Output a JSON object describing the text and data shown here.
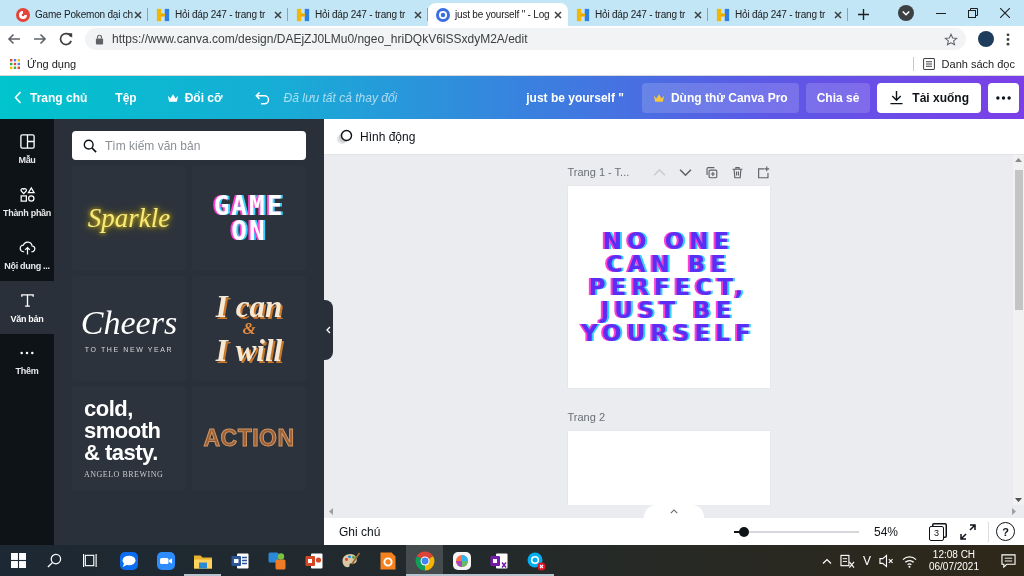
{
  "browser": {
    "tabs": [
      {
        "kind": "game",
        "title": "Game Pokemon đại ch",
        "selected": false
      },
      {
        "kind": "qa",
        "title": "Hỏi đáp 247 - trang tr",
        "selected": false
      },
      {
        "kind": "qa",
        "title": "Hỏi đáp 247 - trang tr",
        "selected": false
      },
      {
        "kind": "design",
        "title": "just be yourself \" - Log",
        "selected": true
      },
      {
        "kind": "qa",
        "title": "Hỏi đáp 247 - trang tr",
        "selected": false
      },
      {
        "kind": "qa",
        "title": "Hỏi đáp 247 - trang tr",
        "selected": false
      }
    ],
    "url": "https://www.canva.com/design/DAEjZJ0LMu0/ngeo_hriDQkV6lSSxdyM2A/edit",
    "apps_label": "Ứng dụng",
    "reading_list": "Danh sách đọc"
  },
  "editor_bar": {
    "home": "Trang chủ",
    "file": "Tệp",
    "resize": "Đổi cỡ",
    "save_status": "Đã lưu tất cả thay đổi",
    "design_title": "just be yourself \"",
    "pro_trial": "Dùng thử Canva Pro",
    "share": "Chia sẻ",
    "download": "Tải xuống"
  },
  "sidebar": {
    "items": [
      {
        "kind": "templates",
        "label": "Mẫu",
        "selected": false
      },
      {
        "kind": "elements",
        "label": "Thành phần",
        "selected": false
      },
      {
        "kind": "uploads",
        "label": "Nội dung ...",
        "selected": false
      },
      {
        "kind": "text",
        "label": "Văn bản",
        "selected": true
      },
      {
        "kind": "more",
        "label": "Thêm",
        "selected": false
      }
    ]
  },
  "text_panel": {
    "search_placeholder": "Tìm kiếm văn bản",
    "styles": [
      {
        "kind": "neon",
        "title": "Sparkle"
      },
      {
        "kind": "pixel",
        "title": "GAME ON"
      },
      {
        "kind": "script",
        "title": "Cheers",
        "subtitle": "TO THE NEW YEAR"
      },
      {
        "kind": "retro",
        "lines": [
          {
            "text": "I can",
            "color": "#f7e8d2"
          },
          {
            "text": "&",
            "color": "#e8893a"
          },
          {
            "text": "I will",
            "color": "#f7e8d2"
          }
        ]
      },
      {
        "kind": "bold",
        "title": "cold, smooth & tasty.",
        "subtitle": "ANGELO BREWING"
      },
      {
        "kind": "outline",
        "title": "ACTION"
      }
    ]
  },
  "toolbar": {
    "animate": "Hình động"
  },
  "pages": [
    {
      "title": "Trang 1 - T...",
      "actions": [
        {
          "kind": "up",
          "disabled": true
        },
        {
          "kind": "down",
          "disabled": false
        },
        {
          "kind": "duplicate",
          "disabled": false
        },
        {
          "kind": "delete",
          "disabled": false
        },
        {
          "kind": "add",
          "disabled": false
        }
      ],
      "quote": "NO ONE CAN BE PERFECT, JUST BE YOURSELF"
    },
    {
      "title": "Trang 2"
    }
  ],
  "bottom_bar": {
    "notes": "Ghi chú",
    "zoom": {
      "level": 0.08
    },
    "zoom_reading": "54%",
    "page_count": "3",
    "help": "?"
  },
  "taskbar": {
    "apps": [
      {
        "kind": "chat",
        "selected": false,
        "running": false
      },
      {
        "kind": "video",
        "selected": false,
        "running": false
      },
      {
        "kind": "folder",
        "selected": false,
        "running": true
      },
      {
        "kind": "word",
        "selected": false,
        "running": false
      },
      {
        "kind": "tiles",
        "selected": false,
        "running": false
      },
      {
        "kind": "slides",
        "selected": false,
        "running": false
      },
      {
        "kind": "palette",
        "selected": false,
        "running": false
      },
      {
        "kind": "orange",
        "selected": false,
        "running": false
      },
      {
        "kind": "browser",
        "selected": true,
        "running": true
      },
      {
        "kind": "wheel",
        "selected": false,
        "running": true
      },
      {
        "kind": "notebook",
        "selected": false,
        "running": true
      },
      {
        "kind": "call",
        "selected": false,
        "running": true
      }
    ],
    "input_method": "V",
    "time": "12:08 CH",
    "date": "06/07/2021"
  }
}
